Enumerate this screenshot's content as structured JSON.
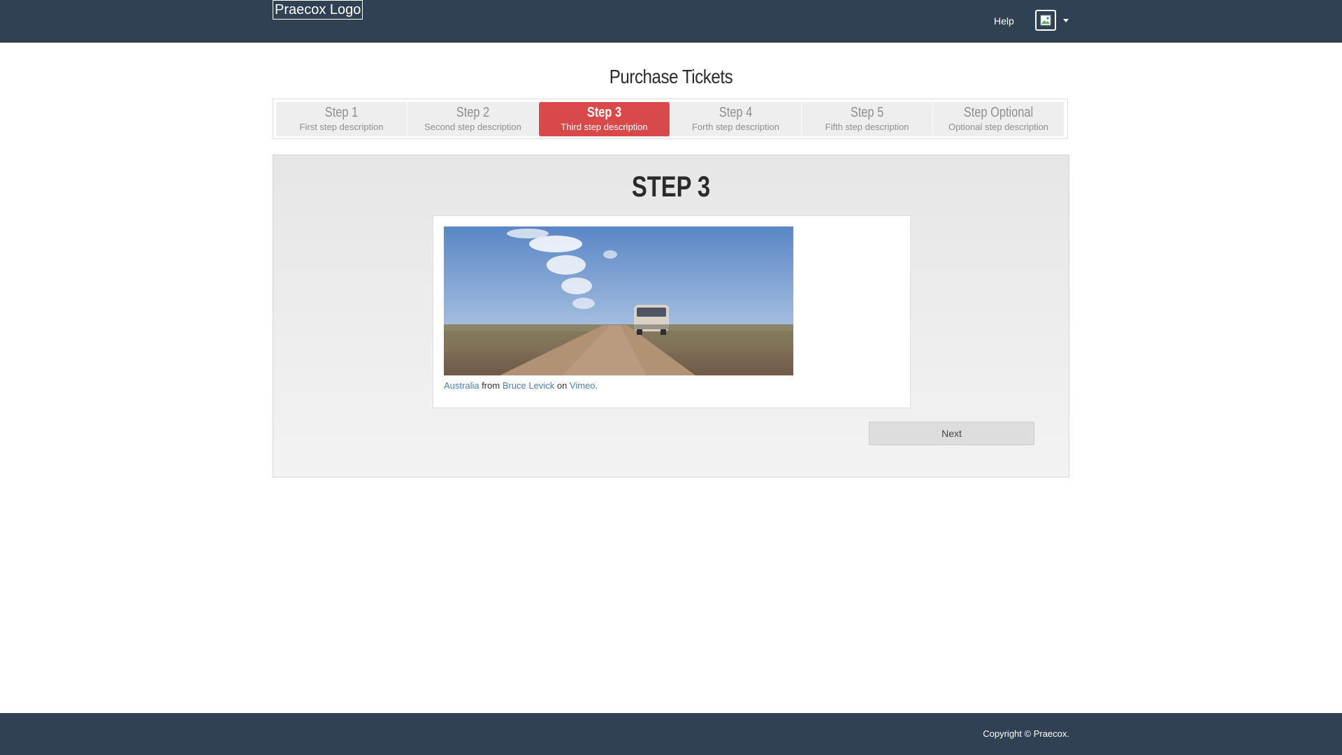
{
  "header": {
    "logo_text": "Praecox Logo",
    "help_label": "Help",
    "user_menu_icon": "broken-image-icon",
    "caret_icon": "caret-down-icon"
  },
  "page": {
    "title": "Purchase Tickets"
  },
  "steps": [
    {
      "title": "Step 1",
      "description": "First step description",
      "active": false
    },
    {
      "title": "Step 2",
      "description": "Second step description",
      "active": false
    },
    {
      "title": "Step 3",
      "description": "Third step description",
      "active": true
    },
    {
      "title": "Step 4",
      "description": "Forth step description",
      "active": false
    },
    {
      "title": "Step 5",
      "description": "Fifth step description",
      "active": false
    },
    {
      "title": "Step Optional",
      "description": "Optional step description",
      "active": false
    }
  ],
  "panel": {
    "heading": "STEP 3",
    "caption": {
      "link1": "Australia",
      "text1": " from ",
      "link2": "Bruce Levick",
      "text2": " on ",
      "link3": "Vimeo",
      "text3": "."
    },
    "next_label": "Next"
  },
  "footer": {
    "copyright": "Copyright © Praecox."
  },
  "colors": {
    "nav_bg": "#2f4153",
    "active_step": "#d9494a",
    "link": "#4a7db0"
  }
}
